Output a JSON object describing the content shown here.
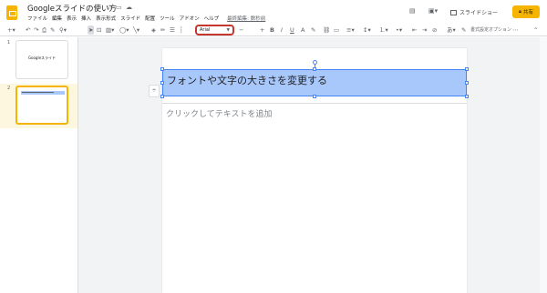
{
  "header": {
    "title": "Googleスライドの使い方",
    "title_icons": [
      "star-icon",
      "move-to-folder-icon",
      "cloud-saved-icon"
    ],
    "menu": [
      "ファイル",
      "編集",
      "表示",
      "挿入",
      "表示形式",
      "スライド",
      "配置",
      "ツール",
      "アドオン",
      "ヘルプ"
    ],
    "last_edit": "最終編集: 数秒前",
    "comments_icon": "comment-icon",
    "present_label": "スライドショー",
    "share_label": "共有",
    "lock_icon": "lock-icon"
  },
  "toolbar": {
    "font_name": "Arial",
    "font_size_minus": "−",
    "font_size_plus": "+",
    "bold": "B",
    "italic": "I",
    "underline": "U",
    "format_options": "書式設定オプション",
    "more": "⋯"
  },
  "filmstrip": {
    "slides": [
      {
        "number": "1",
        "text": "Googleスライド"
      },
      {
        "number": "2",
        "text": ""
      }
    ]
  },
  "canvas": {
    "title_text": "フォントや文字の大きさを変更する",
    "body_placeholder": "クリックしてテキストを追加"
  },
  "colors": {
    "brand_yellow": "#f4b400",
    "selection_blue": "#a8c7fa",
    "highlight_red": "#c5372c"
  }
}
